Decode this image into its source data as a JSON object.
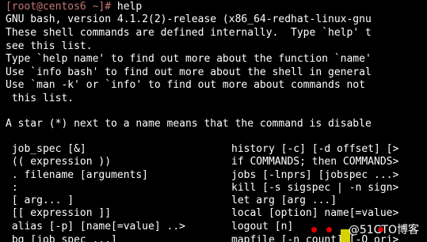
{
  "terminal": {
    "prompt": "[root@centos6 ~]#",
    "command": " help",
    "header_lines": [
      "GNU bash, version 4.1.2(2)-release (x86_64-redhat-linux-gnu",
      "These shell commands are defined internally.  Type `help' t",
      "see this list.",
      "Type `help name' to find out more about the function `name'",
      "Use `info bash' to find out more about the shell in general",
      "Use `man -k' or `info' to find out more about commands not",
      " this list.",
      "",
      "A star (*) next to a name means that the command is disable"
    ],
    "commands_left": [
      " job_spec [&]",
      " (( expression ))",
      " . filename [arguments]",
      " :",
      " [ arg... ]",
      " [[ expression ]]",
      " alias [-p] [name[=value] ..>",
      " bg [job_spec ...]"
    ],
    "commands_right": [
      "history [-c] [-d offset] [>",
      "if COMMANDS; then COMMANDS>",
      "jobs [-lnprs] [jobspec ...>",
      "kill [-s sigspec | -n sign>",
      "let arg [arg ...]",
      "local [option] name[=value>",
      "logout [n]",
      "mapfile [-n count] [-O ori>"
    ]
  },
  "watermark": "@51CTO博客",
  "colors": {
    "background": "#000000",
    "text": "#ffffff",
    "prompt": "#c77777"
  }
}
